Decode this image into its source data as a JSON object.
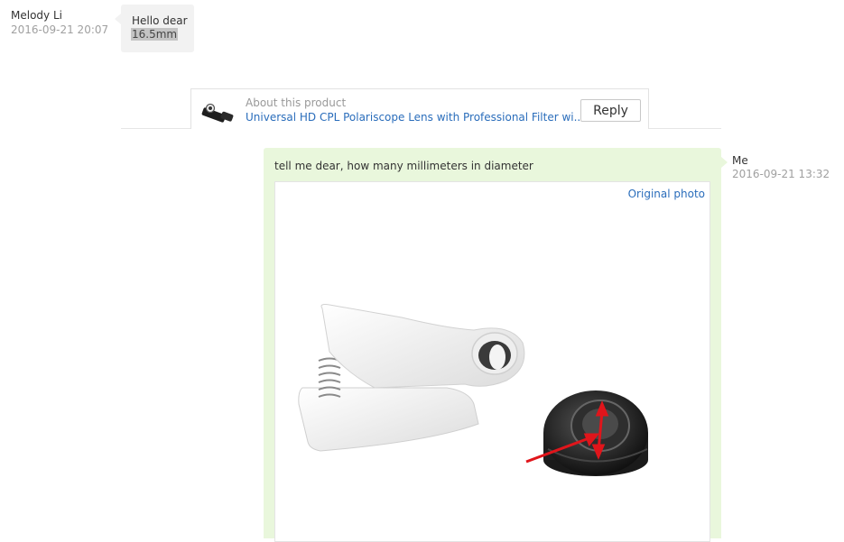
{
  "incoming": {
    "sender": "Melody Li",
    "time": "2016-09-21 20:07",
    "line1": "Hello dear",
    "line2": "16.5mm"
  },
  "product": {
    "label": "About this product",
    "title": "Universal HD CPL Polariscope Lens with Professional Filter wi...",
    "reply_label": "Reply"
  },
  "outgoing": {
    "sender": "Me",
    "time": "2016-09-21 13:32",
    "text": "tell me dear, how many millimeters in diameter",
    "original_photo_label": "Original photo"
  },
  "colors": {
    "link": "#2a6dbb",
    "outgoing_bubble": "#e9f7dc",
    "incoming_bubble": "#f2f2f2",
    "arrow": "#e0151b"
  }
}
